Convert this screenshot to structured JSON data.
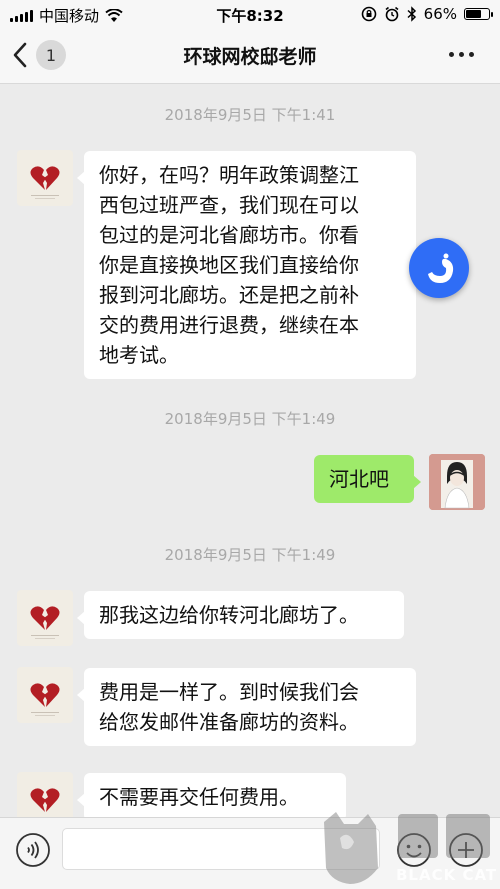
{
  "status_bar": {
    "carrier": "中国移动",
    "time": "下午8:32",
    "battery": "66%",
    "battery_level": 0.66
  },
  "nav": {
    "back_count": "1",
    "title": "环球网校邸老师"
  },
  "messages": [
    {
      "timestamp": "2018年9月5日 下午1:41"
    },
    {
      "side": "left",
      "lines": [
        "你好，在吗？明年政策调整江",
        "西包过班严查，我们现在可以",
        "包过的是河北省廊坊市。你看",
        "你是直接换地区我们直接给你",
        "报到河北廊坊。还是把之前补",
        "交的费用进行退费，继续在本",
        "地考试。"
      ]
    },
    {
      "timestamp": "2018年9月5日 下午1:49"
    },
    {
      "side": "right",
      "lines": [
        "河北吧"
      ]
    },
    {
      "timestamp": "2018年9月5日 下午1:49"
    },
    {
      "side": "left",
      "lines": [
        "那我这边给你转河北廊坊了。"
      ]
    },
    {
      "side": "left",
      "lines": [
        "费用是一样了。到时候我们会",
        "给您发邮件准备廊坊的资料。"
      ]
    },
    {
      "side": "left",
      "lines": [
        "不需要再交任何费用。"
      ]
    }
  ],
  "watermark": {
    "text": "BLACK CAT"
  },
  "colors": {
    "bubble_self": "#9eea6a",
    "bubble_other": "#ffffff",
    "background": "#ebebeb",
    "float_button": "#2f6df6"
  }
}
